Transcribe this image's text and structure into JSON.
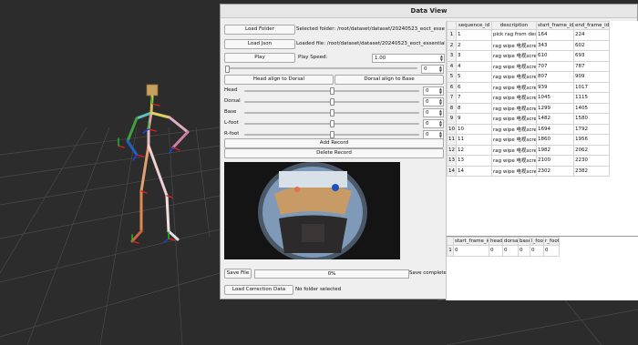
{
  "window": {
    "title": "Data View"
  },
  "controls": {
    "load_folder_label": "Load Folder",
    "selected_folder_text": "Selected folder: /root/dataset/dataset/20240523_eoct_essentialWipe_",
    "load_json_label": "Load Json",
    "loaded_file_text": "Loaded file: /root/dataset/dataset/20240523_eoct_essentialWipe_Fre",
    "play_label": "Play",
    "play_speed_label": "Play Speed:",
    "play_speed_value": "1.00",
    "timeline_value": "0",
    "head_align_label": "Head align to Dorsal",
    "dorsal_align_label": "Dorsal align to Base",
    "sliders": [
      {
        "label": "Head",
        "value": "0"
      },
      {
        "label": "Dorsal",
        "value": "0"
      },
      {
        "label": "Base",
        "value": "0"
      },
      {
        "label": "L-foot",
        "value": "0"
      },
      {
        "label": "R-foot",
        "value": "0"
      }
    ],
    "add_record_label": "Add Record",
    "delete_record_label": "Delete Record",
    "save_file_label": "Save File",
    "progress_text": "0%",
    "progress_value": 0,
    "save_status": "Save completed",
    "load_correction_label": "Load Correction Data",
    "no_folder_text": "No folder selected"
  },
  "records_table": {
    "headers": [
      "sequence_id",
      "description",
      "start_frame_id",
      "end_frame_id"
    ],
    "rows": [
      {
        "n": "1",
        "cells": [
          "1",
          "pick rag from desk",
          "164",
          "224"
        ]
      },
      {
        "n": "2",
        "cells": [
          "2",
          "rag wipe 电视screen",
          "343",
          "602"
        ]
      },
      {
        "n": "3",
        "cells": [
          "3",
          "rag wipe 电视screen",
          "610",
          "693"
        ]
      },
      {
        "n": "4",
        "cells": [
          "4",
          "rag wipe 电视screen",
          "707",
          "787"
        ]
      },
      {
        "n": "5",
        "cells": [
          "5",
          "rag wipe 电视screen",
          "807",
          "909"
        ]
      },
      {
        "n": "6",
        "cells": [
          "6",
          "rag wipe 电视screen",
          "939",
          "1017"
        ]
      },
      {
        "n": "7",
        "cells": [
          "7",
          "rag wipe 电视screen",
          "1045",
          "1115"
        ]
      },
      {
        "n": "8",
        "cells": [
          "8",
          "rag wipe 电视screen",
          "1299",
          "1405"
        ]
      },
      {
        "n": "9",
        "cells": [
          "9",
          "rag wipe 电视screen",
          "1482",
          "1580"
        ]
      },
      {
        "n": "10",
        "cells": [
          "10",
          "rag wipe 电视screen",
          "1694",
          "1792"
        ]
      },
      {
        "n": "11",
        "cells": [
          "11",
          "rag wipe 电视screen",
          "1860",
          "1956"
        ]
      },
      {
        "n": "12",
        "cells": [
          "12",
          "rag wipe 电视screen",
          "1982",
          "2062"
        ]
      },
      {
        "n": "13",
        "cells": [
          "13",
          "rag wipe 电视screen",
          "2100",
          "2230"
        ]
      },
      {
        "n": "14",
        "cells": [
          "14",
          "rag wipe 电视screen",
          "2302",
          "2382"
        ]
      }
    ]
  },
  "correction_table": {
    "headers": [
      "start_frame_id",
      "head",
      "dorsal",
      "base",
      "l_foot",
      "r_foot"
    ],
    "rows": [
      {
        "n": "1",
        "cells": [
          "0",
          "0",
          "0",
          "0",
          "0",
          "0"
        ]
      }
    ]
  },
  "icons": {
    "spin_up": "spin-up-icon",
    "spin_down": "spin-down-icon"
  }
}
